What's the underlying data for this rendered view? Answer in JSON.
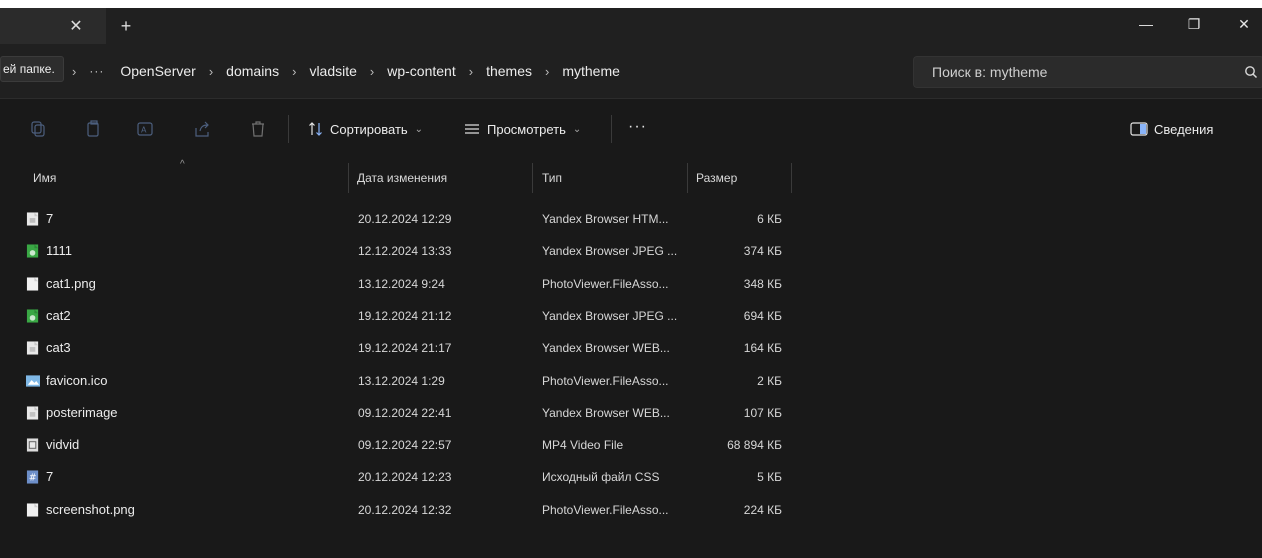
{
  "tab": {
    "close_glyph": "✕",
    "new_glyph": "+"
  },
  "window_controls": {
    "minimize": "—",
    "restore": "❐",
    "close": "✕"
  },
  "tooltip_text": "ей папке.",
  "breadcrumb": {
    "overflow": "···",
    "items": [
      "OpenServer",
      "domains",
      "vladsite",
      "wp-content",
      "themes",
      "mytheme"
    ],
    "separator": "›"
  },
  "search": {
    "placeholder": "Поиск в: mytheme"
  },
  "commandbar": {
    "sort_label": "Сортировать",
    "view_label": "Просмотреть",
    "more_label": "···",
    "details_label": "Сведения"
  },
  "columns": {
    "name": "Имя",
    "date": "Дата изменения",
    "type": "Тип",
    "size": "Размер"
  },
  "files": [
    {
      "name": "7",
      "date": "20.12.2024 12:29",
      "type": "Yandex Browser HTM...",
      "size": "6 КБ",
      "icon": "html-file-icon"
    },
    {
      "name": "1111",
      "date": "12.12.2024 13:33",
      "type": "Yandex Browser JPEG ...",
      "size": "374 КБ",
      "icon": "jpeg-file-icon"
    },
    {
      "name": "cat1.png",
      "date": "13.12.2024 9:24",
      "type": "PhotoViewer.FileAsso...",
      "size": "348 КБ",
      "icon": "png-file-icon"
    },
    {
      "name": "cat2",
      "date": "19.12.2024 21:12",
      "type": "Yandex Browser JPEG ...",
      "size": "694 КБ",
      "icon": "jpeg-file-icon"
    },
    {
      "name": "cat3",
      "date": "19.12.2024 21:17",
      "type": "Yandex Browser WEB...",
      "size": "164 КБ",
      "icon": "webp-file-icon"
    },
    {
      "name": "favicon.ico",
      "date": "13.12.2024 1:29",
      "type": "PhotoViewer.FileAsso...",
      "size": "2 КБ",
      "icon": "ico-file-icon"
    },
    {
      "name": "posterimage",
      "date": "09.12.2024 22:41",
      "type": "Yandex Browser WEB...",
      "size": "107 КБ",
      "icon": "webp-file-icon"
    },
    {
      "name": "vidvid",
      "date": "09.12.2024 22:57",
      "type": "MP4 Video File",
      "size": "68 894 КБ",
      "icon": "video-file-icon"
    },
    {
      "name": "7",
      "date": "20.12.2024 12:23",
      "type": "Исходный файл CSS",
      "size": "5 КБ",
      "icon": "css-file-icon"
    },
    {
      "name": "screenshot.png",
      "date": "20.12.2024 12:32",
      "type": "PhotoViewer.FileAsso...",
      "size": "224 КБ",
      "icon": "png-file-icon"
    }
  ],
  "colors": {
    "background": "#191919",
    "titlebar": "#202020",
    "text": "#ececec",
    "jpeg_icon": "#3aa845"
  }
}
